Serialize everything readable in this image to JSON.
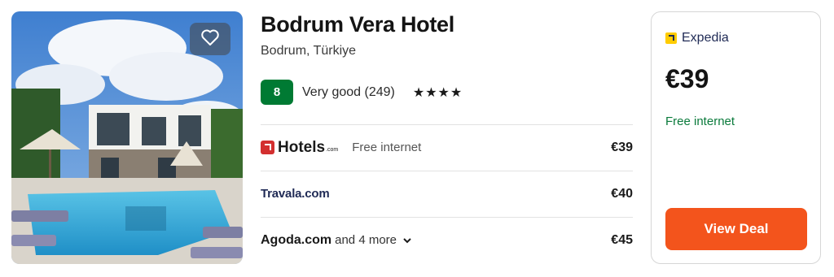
{
  "hotel": {
    "name": "Bodrum Vera Hotel",
    "location": "Bodrum, Türkiye",
    "score": "8",
    "rating_label": "Very good (249)",
    "stars": "★★★★"
  },
  "offers": [
    {
      "provider": "Hotels",
      "provider_suffix": ".com",
      "perk": "Free internet",
      "price": "€39"
    },
    {
      "provider": "Travala.com",
      "perk": "",
      "price": "€40"
    },
    {
      "provider": "Agoda.com",
      "more": "and 4 more",
      "price": "€45"
    }
  ],
  "deal": {
    "provider": "Expedia",
    "price": "€39",
    "perk": "Free internet",
    "button_label": "View Deal"
  },
  "colors": {
    "score_green": "#007a33",
    "deal_button": "#f3541c",
    "perk_green": "#0a7a3b"
  },
  "icons": {
    "favorite": "heart-outline-icon",
    "more": "chevron-down-icon"
  }
}
